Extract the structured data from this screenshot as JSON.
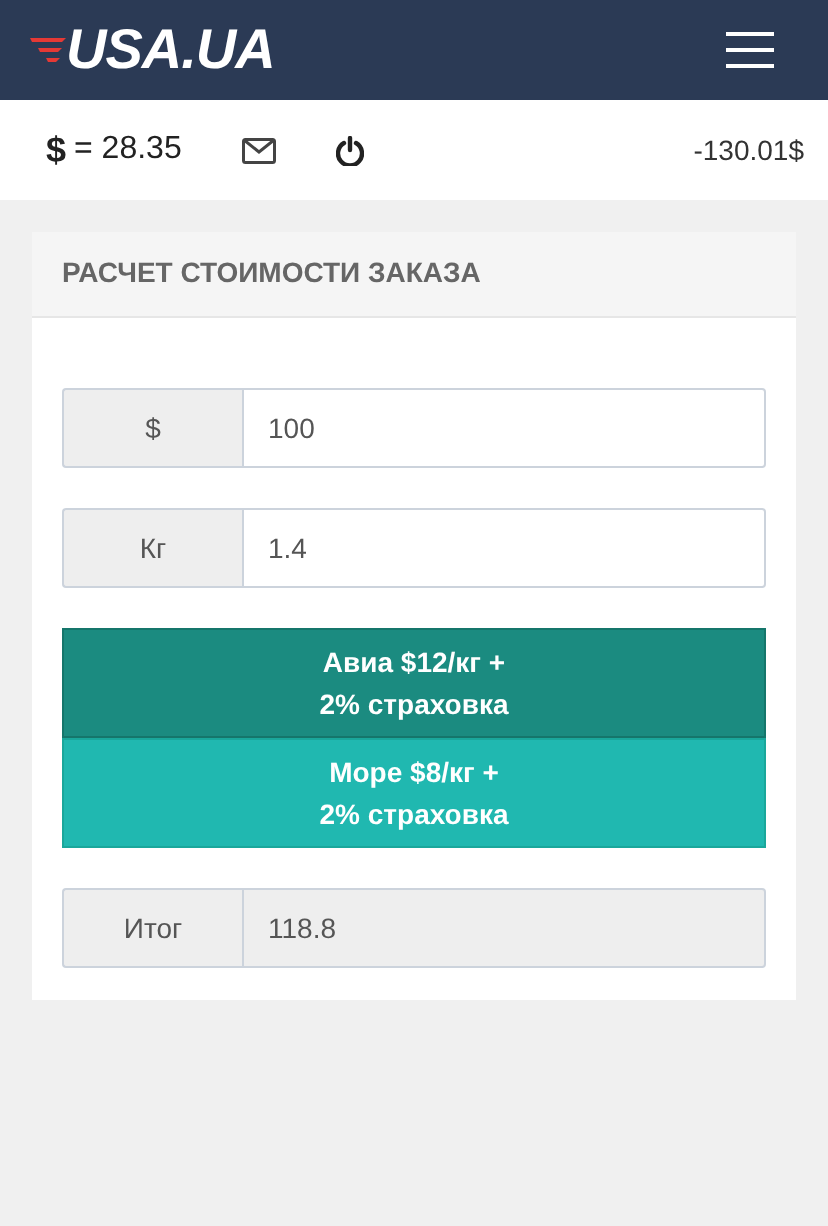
{
  "logo": "USA.UA",
  "toolbar": {
    "rate_symbol": "$",
    "rate": "= 28.35",
    "balance": "-130.01$"
  },
  "calculator": {
    "title": "РАСЧЕТ СТОИМОСТИ ЗАКАЗА",
    "fields": [
      {
        "label": "$",
        "value": "100",
        "disabled": false
      },
      {
        "label": "Кг",
        "value": "1.4",
        "disabled": false
      }
    ],
    "options": [
      {
        "line1": "Авиа $12/кг +",
        "line2": "2% страховка",
        "selected": true
      },
      {
        "line1": "Море $8/кг +",
        "line2": "2% страховка",
        "selected": false
      }
    ],
    "total": {
      "label": "Итог",
      "value": "118.8",
      "disabled": true
    }
  }
}
